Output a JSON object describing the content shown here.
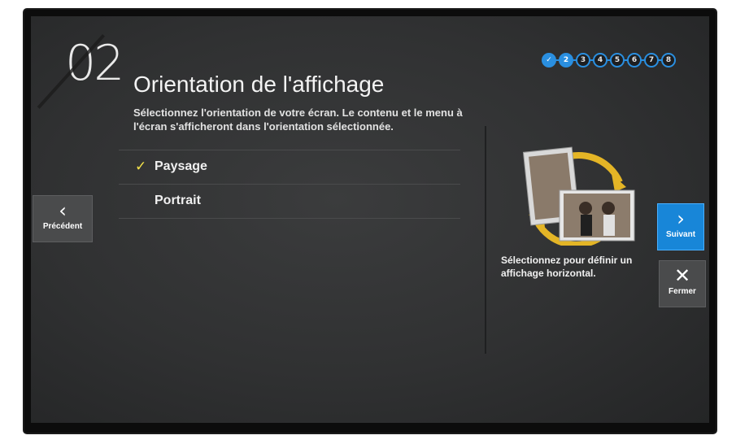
{
  "header": {
    "step_number": "02",
    "title": "Orientation de l'affichage",
    "description": "Sélectionnez l'orientation de votre écran. Le contenu et le menu à l'écran s'afficheront dans l'orientation sélectionnée."
  },
  "progress": {
    "current_step": 2,
    "steps": [
      "✓",
      "2",
      "3",
      "4",
      "5",
      "6",
      "7",
      "8"
    ]
  },
  "options": [
    {
      "label": "Paysage",
      "selected": true
    },
    {
      "label": "Portrait",
      "selected": false
    }
  ],
  "right_panel": {
    "caption": "Sélectionnez pour définir un affichage horizontal."
  },
  "nav": {
    "prev_label": "Précédent",
    "next_label": "Suivant",
    "close_label": "Fermer"
  },
  "colors": {
    "accent": "#1886d8",
    "check": "#f4e24a",
    "background": "#333435"
  }
}
